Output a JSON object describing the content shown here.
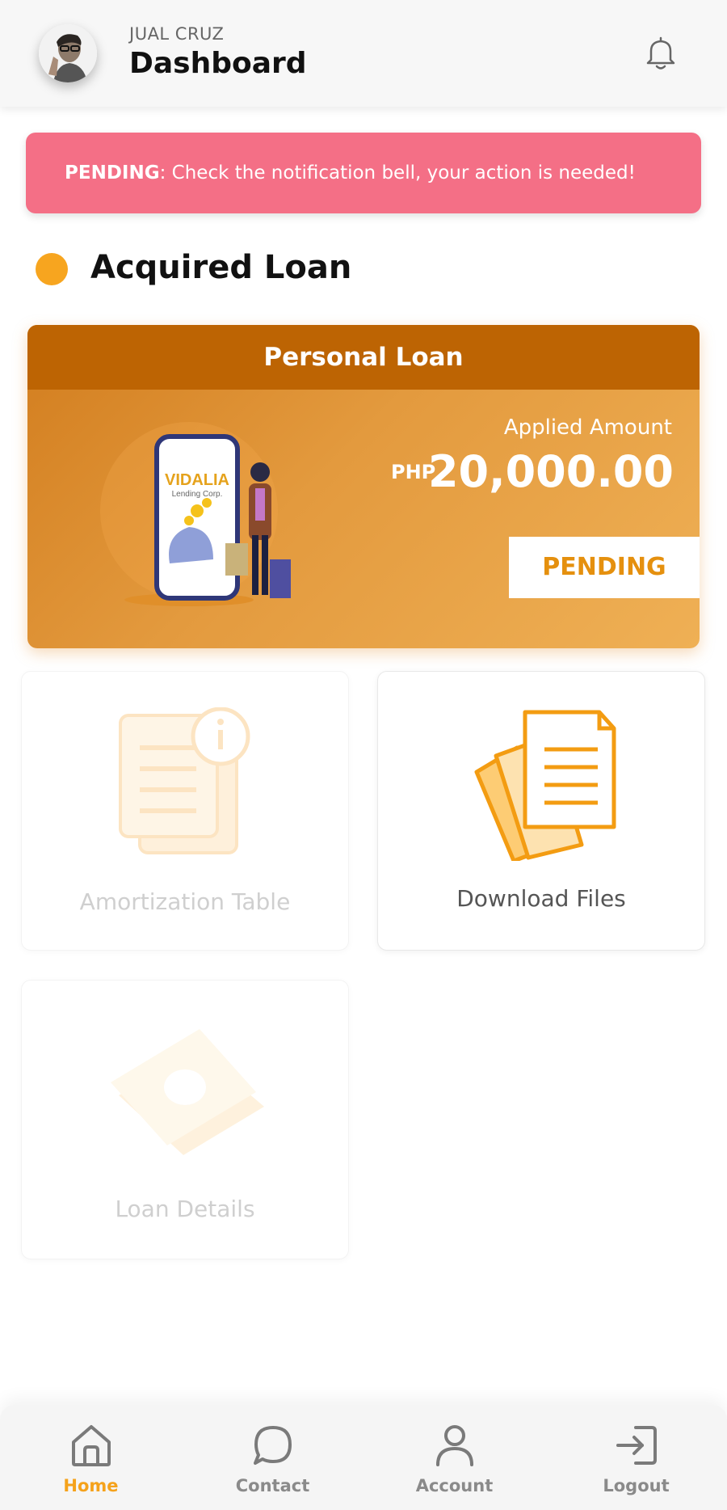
{
  "header": {
    "user_name": "JUAL CRUZ",
    "title": "Dashboard",
    "avatar_icon": "avatar",
    "notification_icon": "bell-icon"
  },
  "alert": {
    "status": "PENDING",
    "message": ": Check the notification bell, your action is needed!",
    "color": "#f46f86"
  },
  "section": {
    "title": "Acquired Loan",
    "dot_color": "#f7a51f"
  },
  "loan_card": {
    "type": "Personal Loan",
    "applied_label": "Applied Amount",
    "currency": "PHP",
    "amount": "20,000.00",
    "status": "PENDING",
    "illustration_brand": "VIDALIA",
    "illustration_sub": "Lending Corp.",
    "header_color": "#bd6403"
  },
  "tiles": [
    {
      "label": "Amortization Table",
      "icon": "document-info-icon",
      "enabled": false
    },
    {
      "label": "Download Files",
      "icon": "files-icon",
      "enabled": true
    },
    {
      "label": "Loan Details",
      "icon": "money-icon",
      "enabled": false
    }
  ],
  "bottom_nav": [
    {
      "label": "Home",
      "icon": "home-icon",
      "active": true
    },
    {
      "label": "Contact",
      "icon": "chat-icon",
      "active": false
    },
    {
      "label": "Account",
      "icon": "user-icon",
      "active": false
    },
    {
      "label": "Logout",
      "icon": "logout-icon",
      "active": false
    }
  ],
  "colors": {
    "accent": "#f5a21b",
    "inactive_nav": "#8a8a8a"
  }
}
